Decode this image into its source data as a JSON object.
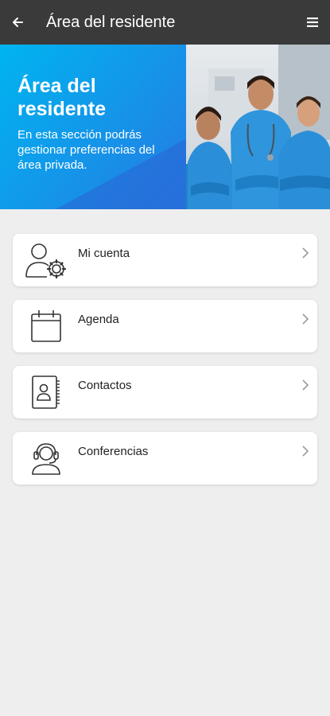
{
  "app_bar": {
    "title": "Área del residente",
    "back_icon": "arrow-left-icon",
    "menu_icon": "hamburger-menu-icon",
    "background": "#3a3a3a"
  },
  "hero": {
    "title_line1": "Área del",
    "title_line2": "residente",
    "subtitle": "En esta sección podrás gestionar preferencias del área privada.",
    "colors": {
      "gradient_start": "#00b4f0",
      "gradient_end": "#2d6fe0"
    }
  },
  "menu": {
    "items": [
      {
        "label": "Mi cuenta",
        "icon": "user-settings-icon"
      },
      {
        "label": "Agenda",
        "icon": "calendar-icon"
      },
      {
        "label": "Contactos",
        "icon": "contact-book-icon"
      },
      {
        "label": "Conferencias",
        "icon": "headset-user-icon"
      }
    ]
  }
}
